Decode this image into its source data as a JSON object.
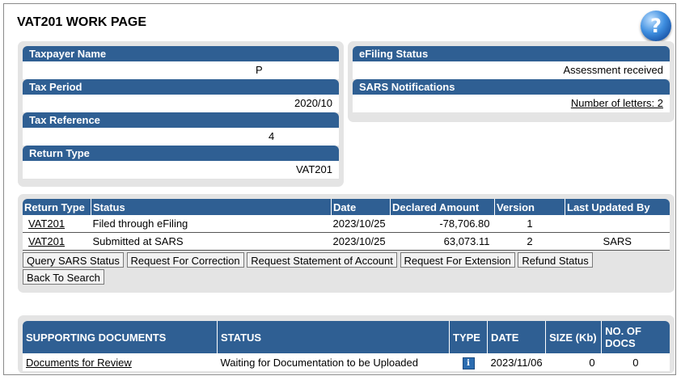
{
  "page": {
    "title": "VAT201 WORK PAGE",
    "help_icon": "?"
  },
  "taxpayer": {
    "name_label": "Taxpayer Name",
    "name_value": "P",
    "period_label": "Tax Period",
    "period_value": "2020/10",
    "reference_label": "Tax Reference",
    "reference_value": "4",
    "return_type_label": "Return Type",
    "return_type_value": "VAT201"
  },
  "efiling": {
    "status_label": "eFiling Status",
    "status_value": "Assessment received",
    "notifications_label": "SARS Notifications",
    "letters_link": "Number of letters: 2"
  },
  "returns_table": {
    "headers": [
      "Return Type",
      "Status",
      "Date",
      "Declared Amount",
      "Version",
      "Last Updated By"
    ],
    "rows": [
      [
        "VAT201",
        "Filed through eFiling",
        "2023/10/25",
        "-78,706.80",
        "1",
        ""
      ],
      [
        "VAT201",
        "Submitted at SARS",
        "2023/10/25",
        "63,073.11",
        "2",
        "SARS"
      ]
    ]
  },
  "actions": {
    "query": "Query SARS Status",
    "correction": "Request For Correction",
    "statement": "Request Statement of Account",
    "extension": "Request For Extension",
    "refund": "Refund Status",
    "back": "Back To Search"
  },
  "supporting_docs": {
    "headers": [
      "SUPPORTING DOCUMENTS",
      "STATUS",
      "TYPE",
      "DATE",
      "SIZE (Kb)",
      "NO. OF DOCS"
    ],
    "rows": [
      {
        "name": "Documents for Review",
        "status": "Waiting for Documentation to be Uploaded",
        "type_icon": "info-icon",
        "date": "2023/11/06",
        "size": "0",
        "docs": "0"
      }
    ]
  },
  "colors": {
    "header_blue": "#2f5f93",
    "panel_gray": "#e4e4e4"
  }
}
